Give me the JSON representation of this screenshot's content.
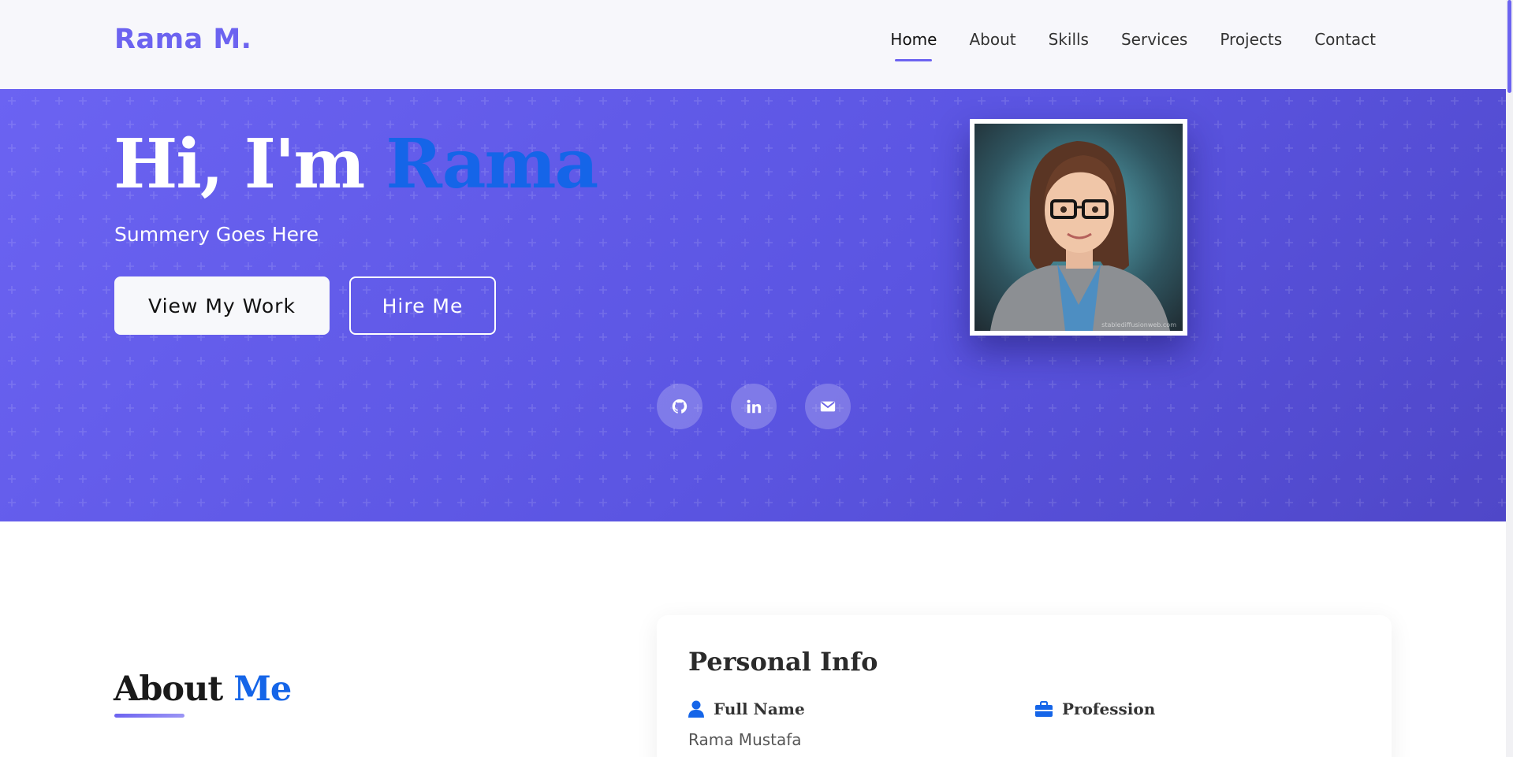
{
  "nav": {
    "brand": "Rama M.",
    "items": [
      {
        "label": "Home",
        "active": true
      },
      {
        "label": "About",
        "active": false
      },
      {
        "label": "Skills",
        "active": false
      },
      {
        "label": "Services",
        "active": false
      },
      {
        "label": "Projects",
        "active": false
      },
      {
        "label": "Contact",
        "active": false
      }
    ]
  },
  "hero": {
    "greeting": "Hi, I'm",
    "name": "Rama",
    "summary": "Summery Goes Here",
    "primary_button": "View My Work",
    "secondary_button": "Hire Me",
    "portrait_watermark": "stablediffusionweb.com",
    "socials": [
      {
        "icon": "github-icon"
      },
      {
        "icon": "linkedin-icon"
      },
      {
        "icon": "envelope-icon"
      }
    ]
  },
  "about": {
    "title_main": "About",
    "title_accent": "Me"
  },
  "personal_info": {
    "heading": "Personal Info",
    "fields": [
      {
        "label": "Full Name",
        "value": "Rama Mustafa",
        "icon": "user-icon"
      },
      {
        "label": "Profession",
        "value": "",
        "icon": "briefcase-icon"
      }
    ]
  },
  "colors": {
    "accent": "#6c63f0",
    "highlight_blue": "#1565e8",
    "hero_start": "#6b63f2",
    "hero_end": "#4f47c8"
  }
}
